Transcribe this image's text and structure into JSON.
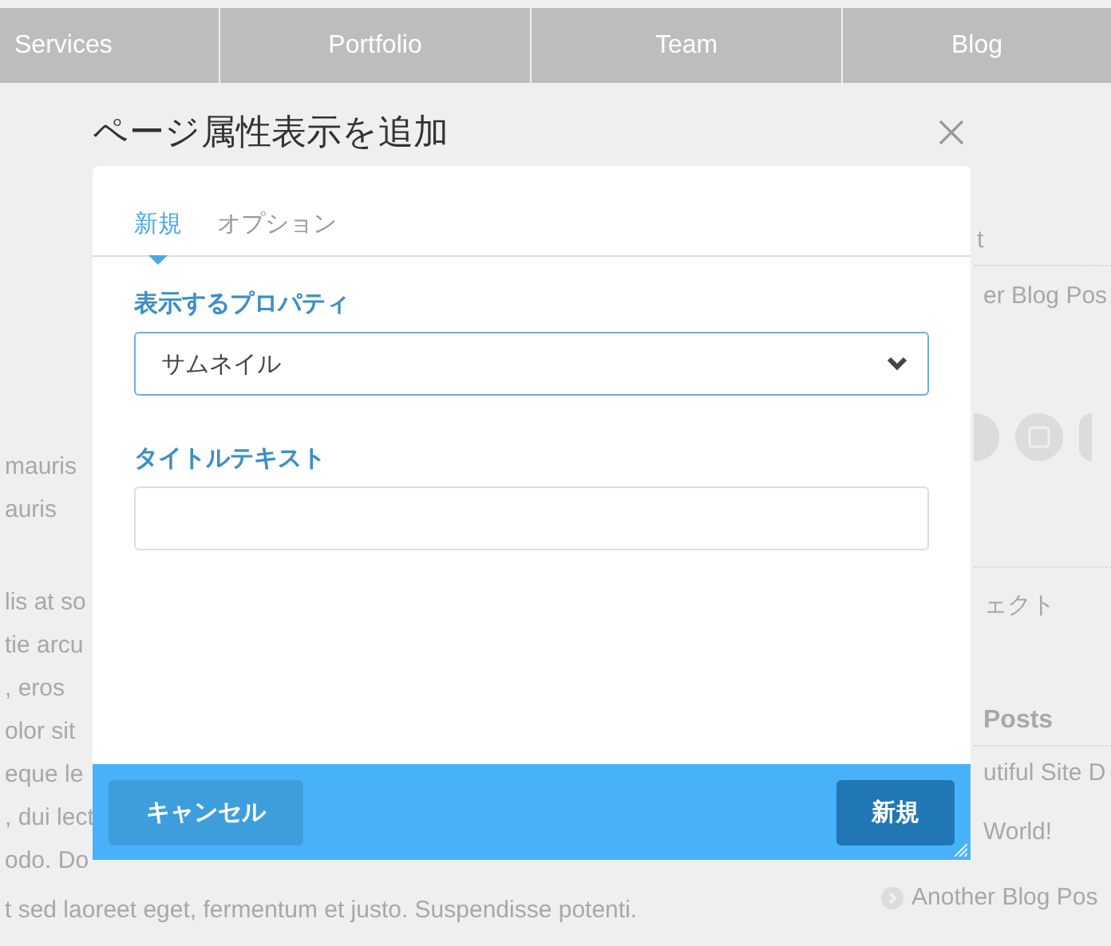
{
  "nav": {
    "items": [
      "Services",
      "Portfolio",
      "Team",
      "Blog"
    ]
  },
  "page": {
    "left_lines": [
      "mauris",
      "auris",
      "lis at so",
      "tie arcu",
      ", eros",
      "olor sit",
      "eque le",
      ", dui lect",
      "odo. Do"
    ],
    "footer_line": "t sed laoreet eget, fermentum et justo. Suspendisse potenti.",
    "sidebar": [
      {
        "kind": "text",
        "text": "t"
      },
      {
        "kind": "text",
        "text": "er Blog Pos"
      },
      {
        "kind": "social"
      },
      {
        "kind": "text",
        "text": "ェクト"
      },
      {
        "kind": "heading",
        "text": "Posts"
      },
      {
        "kind": "text",
        "text": "utiful Site D"
      },
      {
        "kind": "text",
        "text": "World!"
      },
      {
        "kind": "link",
        "text": "Another Blog Pos"
      }
    ]
  },
  "dialog": {
    "title": "ページ属性表示を追加",
    "tabs": [
      {
        "label": "新規",
        "selected": true
      },
      {
        "label": "オプション",
        "selected": false
      }
    ],
    "fields": [
      {
        "kind": "select",
        "label": "表示するプロパティ",
        "value": "サムネイル"
      },
      {
        "kind": "text",
        "label": "タイトルテキスト"
      }
    ],
    "buttons": [
      {
        "kind": "secondary",
        "label": "キャンセル"
      },
      {
        "kind": "primary",
        "label": "新規"
      }
    ]
  }
}
